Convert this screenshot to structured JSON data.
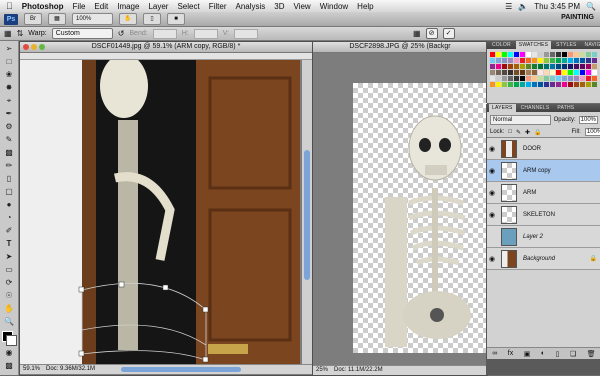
{
  "menubar": {
    "apple": "",
    "items": [
      "Photoshop",
      "File",
      "Edit",
      "Image",
      "Layer",
      "Select",
      "Filter",
      "Analysis",
      "3D",
      "View",
      "Window",
      "Help"
    ],
    "clock": "Thu 3:45 PM"
  },
  "appbar": {
    "logo": "Ps",
    "zoom": "100%",
    "workspace": "PAINTING"
  },
  "options": {
    "warp_label": "Warp:",
    "warp_value": "Custom",
    "bend": "Bend:",
    "h": "H:",
    "v": "V:",
    "cancel": "⊘",
    "commit": "✓"
  },
  "doc1": {
    "title": "DSCF01449.jpg @ 59.1% (ARM copy, RGB/8) *",
    "zoom": "59.1%",
    "info": "Doc: 9.36M/32.1M"
  },
  "doc2": {
    "title": "DSCF2898.JPG @ 25% (Backgr",
    "zoom": "25%",
    "info": "Doc: 11.1M/22.2M"
  },
  "swatches_panel": {
    "tabs": [
      "COLOR",
      "SWATCHES",
      "STYLES",
      "NAVIGATE"
    ]
  },
  "layers_panel": {
    "tabs": [
      "LAYERS",
      "CHANNELS",
      "PATHS"
    ],
    "blend_mode": "Normal",
    "opacity_label": "Opacity:",
    "opacity": "100%",
    "lock_label": "Lock:",
    "fill_label": "Fill:",
    "fill": "100%",
    "layers": [
      {
        "name": "DOOR",
        "selected": false
      },
      {
        "name": "ARM copy",
        "selected": true
      },
      {
        "name": "ARM",
        "selected": false
      },
      {
        "name": "SKELETON",
        "selected": false
      },
      {
        "name": "Layer 2",
        "selected": false
      },
      {
        "name": "Background",
        "selected": false
      }
    ]
  }
}
